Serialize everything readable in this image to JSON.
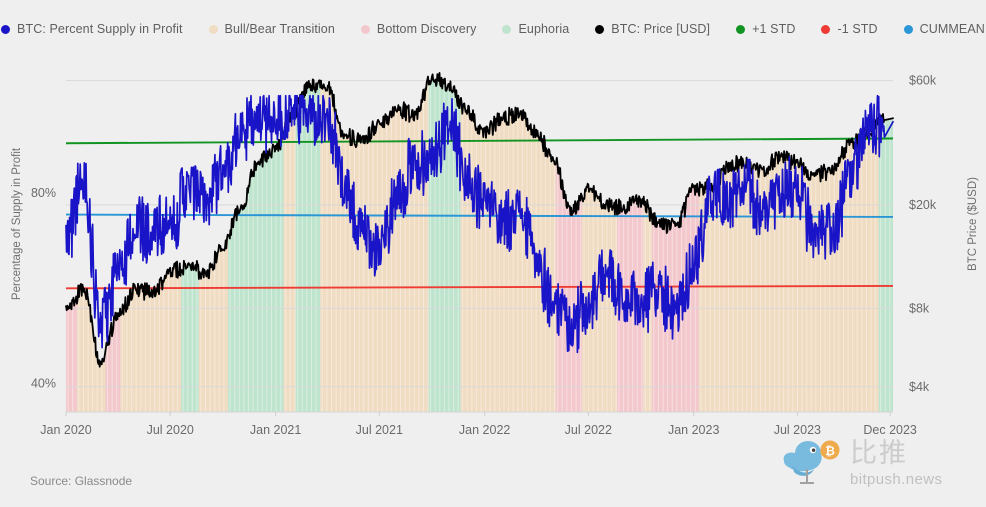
{
  "legend": [
    {
      "label": "BTC: Percent Supply in Profit",
      "color": "#1a14c8",
      "name": "legend-btc-percent-supply"
    },
    {
      "label": "Bull/Bear Transition",
      "color": "#f0dcc2",
      "name": "legend-bull-bear-transition"
    },
    {
      "label": "Bottom Discovery",
      "color": "#f3c8cd",
      "name": "legend-bottom-discovery"
    },
    {
      "label": "Euphoria",
      "color": "#bfe4ce",
      "name": "legend-euphoria"
    },
    {
      "label": "BTC: Price [USD]",
      "color": "#000000",
      "name": "legend-btc-price"
    },
    {
      "label": "+1 STD",
      "color": "#119422",
      "name": "legend-plus-1-std"
    },
    {
      "label": "-1 STD",
      "color": "#ee3b33",
      "name": "legend-minus-1-std"
    },
    {
      "label": "CUMMEAN",
      "color": "#2b96d6",
      "name": "legend-cummean"
    }
  ],
  "axes": {
    "left_title": "Percentage of Supply in Profit",
    "right_title": "BTC Price ($USD)",
    "left_ticks": [
      "80%",
      "40%"
    ],
    "right_ticks": [
      "$60k",
      "$20k",
      "$8k",
      "$4k"
    ],
    "x_ticks": [
      "Jan 2020",
      "Jul 2020",
      "Jan 2021",
      "Jul 2021",
      "Jan 2022",
      "Jul 2022",
      "Jan 2023",
      "Jul 2023",
      "Dec 2023"
    ]
  },
  "footer": {
    "source": "Source: Glassnode"
  },
  "watermark": {
    "cn": "比推",
    "en": "bitpush.news"
  },
  "chart_data": {
    "type": "line",
    "title": "",
    "subtitle": "",
    "xlabel": "",
    "ylabel": "Percentage of Supply in Profit",
    "y2label": "BTC Price ($USD)",
    "grid": true,
    "legend_position": "top",
    "x_range": [
      "2020-01-01",
      "2023-12-15"
    ],
    "x_tick_labels": [
      "Jan 2020",
      "Jul 2020",
      "Jan 2021",
      "Jul 2021",
      "Jan 2022",
      "Jul 2022",
      "Jan 2023",
      "Jul 2023",
      "Dec 2023"
    ],
    "y_left": {
      "label": "Percentage of Supply in Profit",
      "ticks": [
        40,
        80
      ],
      "tick_labels": [
        "40%",
        "80%"
      ],
      "range": [
        34,
        108
      ],
      "unit": "%"
    },
    "y_right": {
      "label": "BTC Price ($USD)",
      "scale": "log",
      "ticks": [
        4000,
        8000,
        20000,
        60000
      ],
      "tick_labels": [
        "$4k",
        "$8k",
        "$20k",
        "$60k"
      ],
      "range": [
        3200,
        72000
      ],
      "unit": "USD"
    },
    "shaded_regions": [
      {
        "label": "Bottom Discovery",
        "color": "#f3c8cd",
        "start": "2020-01-01",
        "end": "2020-01-20"
      },
      {
        "label": "Bull/Bear Transition",
        "color": "#f0dcc2",
        "start": "2020-01-20",
        "end": "2020-03-10"
      },
      {
        "label": "Bottom Discovery",
        "color": "#f3c8cd",
        "start": "2020-03-10",
        "end": "2020-04-05"
      },
      {
        "label": "Bull/Bear Transition",
        "color": "#f0dcc2",
        "start": "2020-04-05",
        "end": "2020-07-20"
      },
      {
        "label": "Euphoria",
        "color": "#bfe4ce",
        "start": "2020-07-20",
        "end": "2020-08-20"
      },
      {
        "label": "Bull/Bear Transition",
        "color": "#f0dcc2",
        "start": "2020-08-20",
        "end": "2020-10-10"
      },
      {
        "label": "Euphoria",
        "color": "#bfe4ce",
        "start": "2020-10-10",
        "end": "2021-01-15"
      },
      {
        "label": "Bull/Bear Transition",
        "color": "#f0dcc2",
        "start": "2021-01-15",
        "end": "2021-02-05"
      },
      {
        "label": "Euphoria",
        "color": "#bfe4ce",
        "start": "2021-02-05",
        "end": "2021-03-20"
      },
      {
        "label": "Bull/Bear Transition",
        "color": "#f0dcc2",
        "start": "2021-03-20",
        "end": "2021-09-25"
      },
      {
        "label": "Euphoria",
        "color": "#bfe4ce",
        "start": "2021-09-25",
        "end": "2021-11-20"
      },
      {
        "label": "Bull/Bear Transition",
        "color": "#f0dcc2",
        "start": "2021-11-20",
        "end": "2022-05-05"
      },
      {
        "label": "Bottom Discovery",
        "color": "#f3c8cd",
        "start": "2022-05-05",
        "end": "2022-06-20"
      },
      {
        "label": "Bull/Bear Transition",
        "color": "#f0dcc2",
        "start": "2022-06-20",
        "end": "2022-08-20"
      },
      {
        "label": "Bottom Discovery",
        "color": "#f3c8cd",
        "start": "2022-08-20",
        "end": "2022-10-05"
      },
      {
        "label": "Bull/Bear Transition",
        "color": "#f0dcc2",
        "start": "2022-10-05",
        "end": "2022-10-20"
      },
      {
        "label": "Bottom Discovery",
        "color": "#f3c8cd",
        "start": "2022-10-20",
        "end": "2023-01-10"
      },
      {
        "label": "Bull/Bear Transition",
        "color": "#f0dcc2",
        "start": "2023-01-10",
        "end": "2023-11-20"
      },
      {
        "label": "Euphoria",
        "color": "#bfe4ce",
        "start": "2023-11-20",
        "end": "2023-12-15"
      }
    ],
    "series": [
      {
        "name": "BTC: Percent Supply in Profit",
        "color": "#1a14c8",
        "axis": "left",
        "unit": "%",
        "note": "Noisy oscillator between ~41% and ~100%",
        "x": [
          "2020-01",
          "2020-02",
          "2020-03",
          "2020-04",
          "2020-05",
          "2020-06",
          "2020-07",
          "2020-08",
          "2020-09",
          "2020-10",
          "2020-11",
          "2020-12",
          "2021-01",
          "2021-02",
          "2021-03",
          "2021-04",
          "2021-05",
          "2021-06",
          "2021-07",
          "2021-08",
          "2021-09",
          "2021-10",
          "2021-11",
          "2021-12",
          "2022-01",
          "2022-02",
          "2022-03",
          "2022-04",
          "2022-05",
          "2022-06",
          "2022-07",
          "2022-08",
          "2022-09",
          "2022-10",
          "2022-11",
          "2022-12",
          "2023-01",
          "2023-02",
          "2023-03",
          "2023-04",
          "2023-05",
          "2023-06",
          "2023-07",
          "2023-08",
          "2023-09",
          "2023-10",
          "2023-11",
          "2023-12"
        ],
        "values": [
          70,
          83,
          52,
          63,
          73,
          72,
          73,
          81,
          78,
          85,
          93,
          95,
          96,
          97,
          97,
          96,
          82,
          72,
          68,
          80,
          86,
          88,
          95,
          83,
          78,
          74,
          77,
          66,
          57,
          52,
          56,
          63,
          57,
          57,
          60,
          54,
          65,
          79,
          78,
          82,
          76,
          80,
          81,
          70,
          72,
          83,
          93,
          95
        ]
      },
      {
        "name": "BTC: Price [USD]",
        "color": "#000000",
        "axis": "right",
        "unit": "USD",
        "x": [
          "2020-01",
          "2020-02",
          "2020-03",
          "2020-04",
          "2020-05",
          "2020-06",
          "2020-07",
          "2020-08",
          "2020-09",
          "2020-10",
          "2020-11",
          "2020-12",
          "2021-01",
          "2021-02",
          "2021-03",
          "2021-04",
          "2021-05",
          "2021-06",
          "2021-07",
          "2021-08",
          "2021-09",
          "2021-10",
          "2021-11",
          "2021-12",
          "2022-01",
          "2022-02",
          "2022-03",
          "2022-04",
          "2022-05",
          "2022-06",
          "2022-07",
          "2022-08",
          "2022-09",
          "2022-10",
          "2022-11",
          "2022-12",
          "2023-01",
          "2023-02",
          "2023-03",
          "2023-04",
          "2023-05",
          "2023-06",
          "2023-07",
          "2023-08",
          "2023-09",
          "2023-10",
          "2023-11",
          "2023-12"
        ],
        "values": [
          8000,
          9500,
          5000,
          7500,
          9500,
          9200,
          11000,
          11700,
          10800,
          13800,
          19500,
          29000,
          33000,
          45000,
          58000,
          57000,
          37000,
          35000,
          41000,
          47000,
          44000,
          61000,
          57000,
          46000,
          38000,
          43000,
          45000,
          38000,
          30000,
          19000,
          23000,
          20000,
          19500,
          20500,
          17000,
          16500,
          23000,
          23500,
          28000,
          29000,
          27000,
          30500,
          29200,
          26000,
          27000,
          34500,
          37500,
          43000
        ]
      },
      {
        "name": "+1 STD",
        "color": "#119422",
        "axis": "left",
        "type": "reference-line",
        "values": [
          90.5,
          91.5
        ],
        "note": "Nearly flat, slowly rising from ~90.5% to ~91.5%"
      },
      {
        "name": "CUMMEAN",
        "color": "#2b96d6",
        "axis": "left",
        "type": "reference-line",
        "values": [
          75.5,
          75.0
        ],
        "note": "Nearly flat around 75%"
      },
      {
        "name": "-1 STD",
        "color": "#ee3b33",
        "axis": "left",
        "type": "reference-line",
        "values": [
          60.0,
          60.5
        ],
        "note": "Nearly flat around 60%"
      }
    ]
  }
}
